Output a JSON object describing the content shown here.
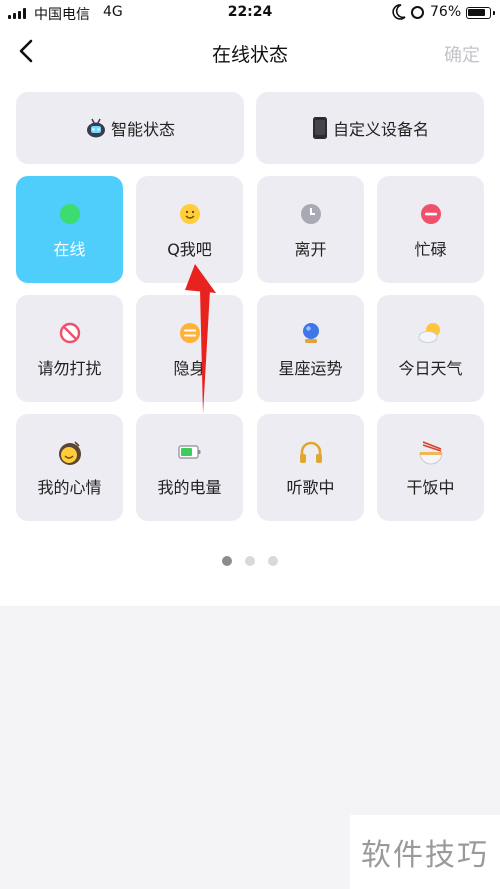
{
  "status_bar": {
    "carrier": "中国电信",
    "network": "4G",
    "time": "22:24",
    "battery": "76%"
  },
  "nav": {
    "title": "在线状态",
    "confirm": "确定"
  },
  "top_buttons": [
    {
      "label": "智能状态",
      "icon": "robot-icon"
    },
    {
      "label": "自定义设备名",
      "icon": "phone-icon"
    }
  ],
  "tiles": [
    {
      "label": "在线",
      "icon": "green-dot-icon",
      "active": true
    },
    {
      "label": "Q我吧",
      "icon": "smile-icon"
    },
    {
      "label": "离开",
      "icon": "clock-icon"
    },
    {
      "label": "忙碌",
      "icon": "busy-icon"
    },
    {
      "label": "请勿打扰",
      "icon": "no-entry-icon"
    },
    {
      "label": "隐身",
      "icon": "invisible-icon"
    },
    {
      "label": "星座运势",
      "icon": "crystal-ball-icon"
    },
    {
      "label": "今日天气",
      "icon": "weather-icon"
    },
    {
      "label": "我的心情",
      "icon": "mood-icon"
    },
    {
      "label": "我的电量",
      "icon": "battery-icon"
    },
    {
      "label": "听歌中",
      "icon": "headphones-icon"
    },
    {
      "label": "干饭中",
      "icon": "noodle-bowl-icon"
    }
  ],
  "pagination": {
    "pages": 3,
    "current": 1
  },
  "watermark": "软件技巧",
  "colors": {
    "active_tile": "#4fcdfb",
    "arrow": "#e8231e"
  }
}
